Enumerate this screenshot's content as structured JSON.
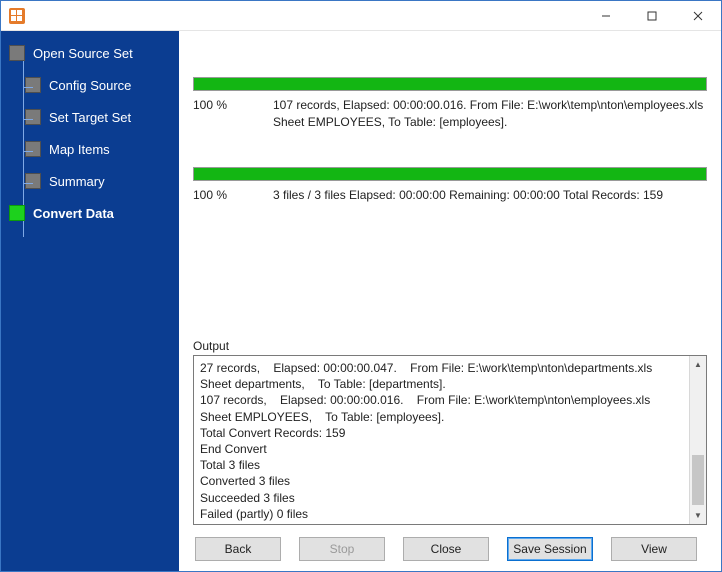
{
  "title": "",
  "sidebar": {
    "items": [
      {
        "label": "Open Source Set",
        "active": false,
        "child": false
      },
      {
        "label": "Config Source",
        "active": false,
        "child": true
      },
      {
        "label": "Set Target Set",
        "active": false,
        "child": true
      },
      {
        "label": "Map Items",
        "active": false,
        "child": true
      },
      {
        "label": "Summary",
        "active": false,
        "child": true
      },
      {
        "label": "Convert Data",
        "active": true,
        "child": false
      }
    ]
  },
  "progress1": {
    "percent": "100 %",
    "text": "107 records,    Elapsed: 00:00:00.016.    From File: E:\\work\\temp\\nton\\employees.xls Sheet EMPLOYEES,    To Table: [employees]."
  },
  "progress2": {
    "percent": "100 %",
    "text": "3 files / 3 files    Elapsed: 00:00:00    Remaining: 00:00:00    Total Records: 159"
  },
  "output": {
    "label": "Output",
    "text": "27 records,    Elapsed: 00:00:00.047.    From File: E:\\work\\temp\\nton\\departments.xls Sheet departments,    To Table: [departments].\n107 records,    Elapsed: 00:00:00.016.    From File: E:\\work\\temp\\nton\\employees.xls Sheet EMPLOYEES,    To Table: [employees].\nTotal Convert Records: 159\nEnd Convert\nTotal 3 files\nConverted 3 files\nSucceeded 3 files\nFailed (partly) 0 files"
  },
  "buttons": {
    "back": "Back",
    "stop": "Stop",
    "close": "Close",
    "save_session": "Save Session",
    "view": "View"
  },
  "colors": {
    "accent_blue": "#0b3d91",
    "progress_green": "#13b613",
    "orange": "#e57b2a"
  }
}
